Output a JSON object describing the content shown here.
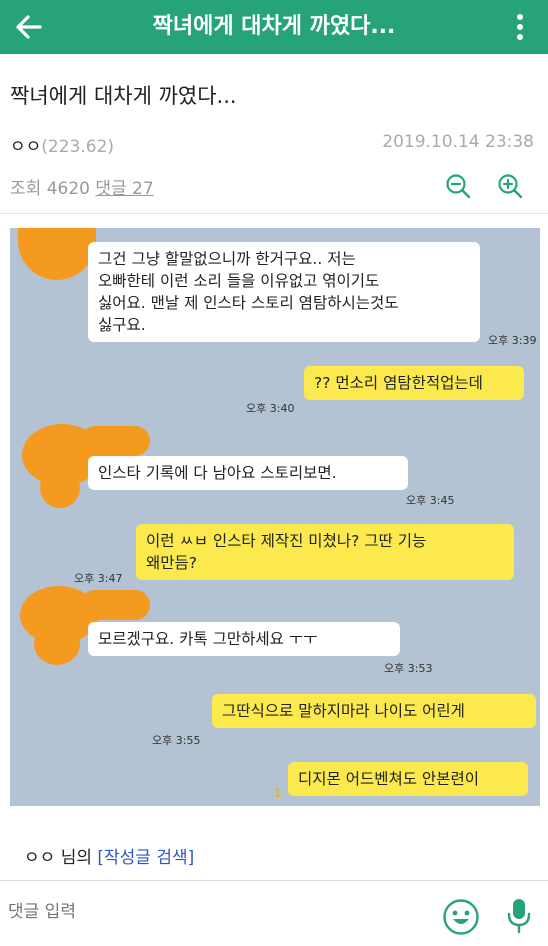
{
  "header": {
    "title": "짝녀에게 대차게 까였다...",
    "back_icon": "arrow-left-icon",
    "more_icon": "more-vertical-icon",
    "bg_color": "#27a37a"
  },
  "post": {
    "title": "짝녀에게 대차게 까였다...",
    "author": "ㅇㅇ",
    "ip": "(223.62)",
    "date": "2019.10.14 23:38",
    "views_label": "조회",
    "views": "4620",
    "comments_label": "댓글",
    "comments": "27"
  },
  "chat": {
    "messages": [
      {
        "side": "in",
        "text": "그건 그냥 할말없으니까 한거구요.. 저는\n오빠한테 이런 소리 들을 이유없고 엮이기도\n싫어요. 맨날 제 인스타 스토리 염탐하시는것도\n싫구요.",
        "time": "오후 3:39"
      },
      {
        "side": "out",
        "text": "?? 먼소리 염탐한적업는데",
        "time": "오후 3:40"
      },
      {
        "side": "in",
        "text": "인스타 기록에 다 남아요 스토리보면.",
        "time": "오후 3:45"
      },
      {
        "side": "out",
        "text": "이런 ㅆㅂ 인스타 제작진 미쳤나? 그딴 기능\n왜만듬?",
        "time": "오후 3:47"
      },
      {
        "side": "in",
        "text": "모르겠구요. 카톡 그만하세요 ㅜㅜ",
        "time": "오후 3:53"
      },
      {
        "side": "out",
        "text": "그딴식으로 말하지마라 나이도 어린게",
        "time": "오후 3:55"
      },
      {
        "side": "out",
        "text": "디지몬 어드벤쳐도 안본련이",
        "unread": "1",
        "time": ""
      }
    ]
  },
  "footer": {
    "author": "ㅇㅇ",
    "suffix": "님의",
    "search_link": "[작성글 검색]",
    "comment_placeholder": "댓글 입력"
  }
}
